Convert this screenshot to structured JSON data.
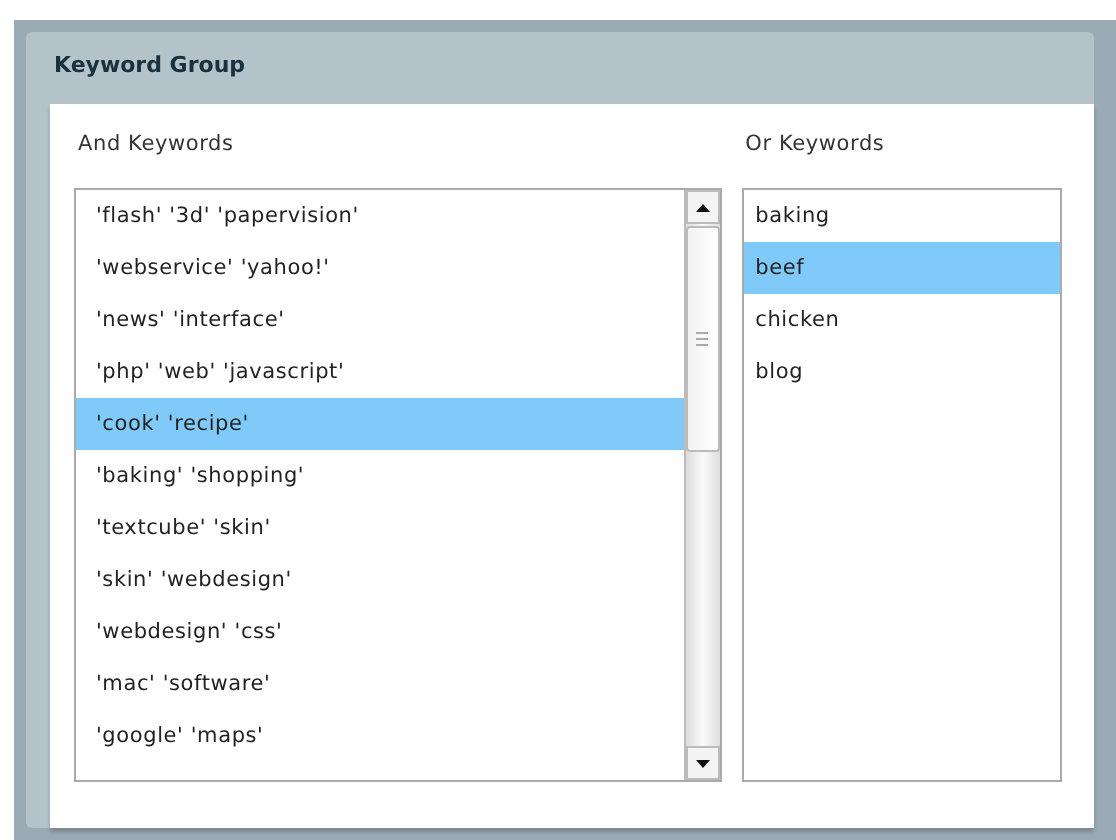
{
  "panel": {
    "title": "Keyword Group"
  },
  "and_keywords": {
    "label": "And Keywords",
    "items": [
      {
        "text": "'flash' '3d' 'papervision'",
        "selected": false
      },
      {
        "text": "'webservice' 'yahoo!'",
        "selected": false
      },
      {
        "text": "'news' 'interface'",
        "selected": false
      },
      {
        "text": "'php' 'web' 'javascript'",
        "selected": false
      },
      {
        "text": "'cook' 'recipe'",
        "selected": true
      },
      {
        "text": "'baking' 'shopping'",
        "selected": false
      },
      {
        "text": "'textcube' 'skin'",
        "selected": false
      },
      {
        "text": "'skin' 'webdesign'",
        "selected": false
      },
      {
        "text": "'webdesign' 'css'",
        "selected": false
      },
      {
        "text": "'mac' 'software'",
        "selected": false
      },
      {
        "text": "'google' 'maps'",
        "selected": false
      }
    ]
  },
  "or_keywords": {
    "label": "Or Keywords",
    "items": [
      {
        "text": "baking",
        "selected": false
      },
      {
        "text": "beef",
        "selected": true
      },
      {
        "text": "chicken",
        "selected": false
      },
      {
        "text": "blog",
        "selected": false
      }
    ]
  }
}
